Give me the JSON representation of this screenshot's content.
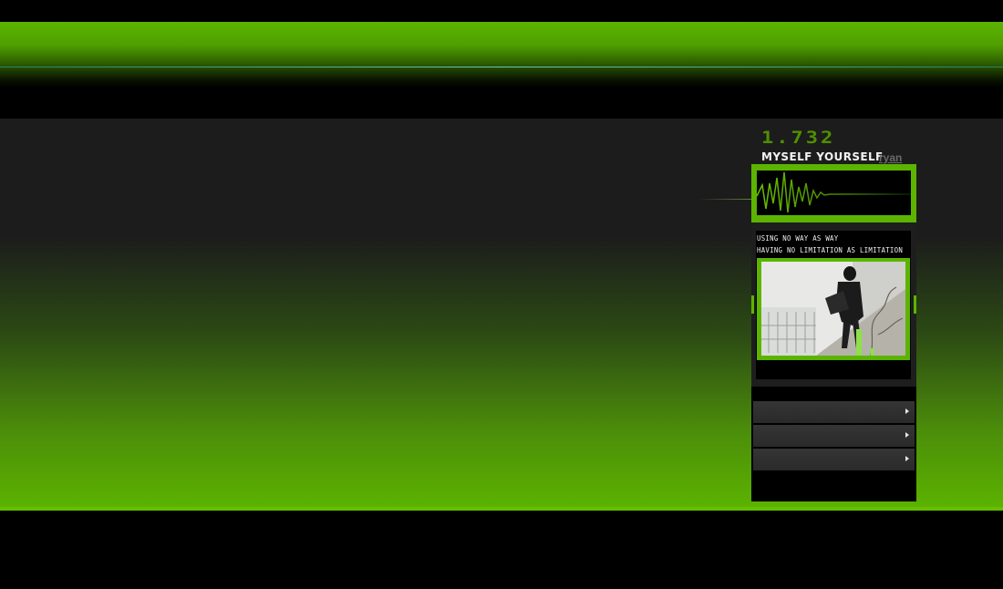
{
  "header": {
    "logo_number": "1.732",
    "logo_title": "MYSELF  YOURSELF",
    "user_link": "ryan"
  },
  "sidebar": {
    "quote_lines": [
      "Using no way as way",
      "Having no limitation as limitation"
    ],
    "nav_items": [
      {
        "label": "",
        "icon": "arrow-right-icon"
      },
      {
        "label": "",
        "icon": "arrow-right-icon"
      },
      {
        "label": "",
        "icon": "arrow-right-icon"
      }
    ]
  },
  "colors": {
    "accent": "#5cb400",
    "background": "#000000",
    "panel_dark": "#1e1e1e"
  }
}
